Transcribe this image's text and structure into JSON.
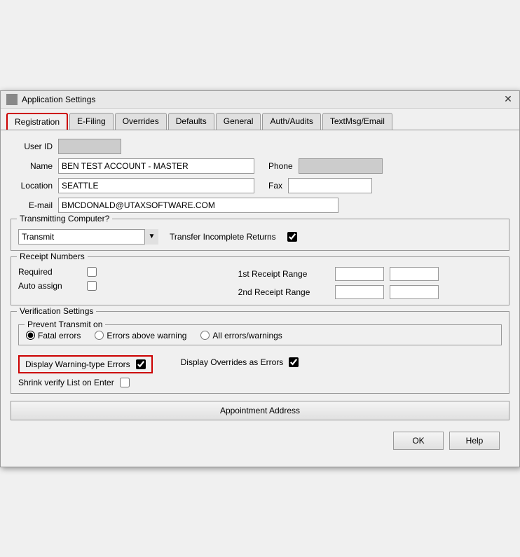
{
  "window": {
    "title": "Application Settings",
    "close_label": "✕"
  },
  "tabs": [
    {
      "id": "registration",
      "label": "Registration",
      "active": true
    },
    {
      "id": "efiling",
      "label": "E-Filing",
      "active": false
    },
    {
      "id": "overrides",
      "label": "Overrides",
      "active": false
    },
    {
      "id": "defaults",
      "label": "Defaults",
      "active": false
    },
    {
      "id": "general",
      "label": "General",
      "active": false
    },
    {
      "id": "auth-audits",
      "label": "Auth/Audits",
      "active": false
    },
    {
      "id": "textmsg-email",
      "label": "TextMsg/Email",
      "active": false
    }
  ],
  "form": {
    "user_id_label": "User ID",
    "user_id_value": "",
    "name_label": "Name",
    "name_value": "BEN TEST ACCOUNT - MASTER",
    "phone_label": "Phone",
    "phone_value": "",
    "location_label": "Location",
    "location_value": "SEATTLE",
    "fax_label": "Fax",
    "fax_value": "",
    "email_label": "E-mail",
    "email_value": "BMCDONALD@UTAXSOFTWARE.COM"
  },
  "transmitting": {
    "section_label": "Transmitting Computer?",
    "select_value": "Transmit",
    "select_options": [
      "Transmit"
    ],
    "transfer_label": "Transfer Incomplete Returns",
    "transfer_checked": true
  },
  "receipt": {
    "section_label": "Receipt Numbers",
    "required_label": "Required",
    "required_checked": false,
    "auto_assign_label": "Auto assign",
    "auto_assign_checked": false,
    "first_range_label": "1st Receipt Range",
    "second_range_label": "2nd Receipt Range"
  },
  "verification": {
    "section_label": "Verification Settings",
    "prevent_label": "Prevent Transmit on",
    "fatal_errors_label": "Fatal errors",
    "errors_above_label": "Errors above warning",
    "all_errors_label": "All errors/warnings",
    "selected_radio": "fatal",
    "display_warning_label": "Display Warning-type Errors",
    "display_warning_checked": true,
    "display_overrides_label": "Display Overrides as Errors",
    "display_overrides_checked": true,
    "shrink_verify_label": "Shrink verify List on Enter",
    "shrink_verify_checked": false
  },
  "appointment": {
    "button_label": "Appointment Address"
  },
  "footer": {
    "ok_label": "OK",
    "help_label": "Help"
  }
}
